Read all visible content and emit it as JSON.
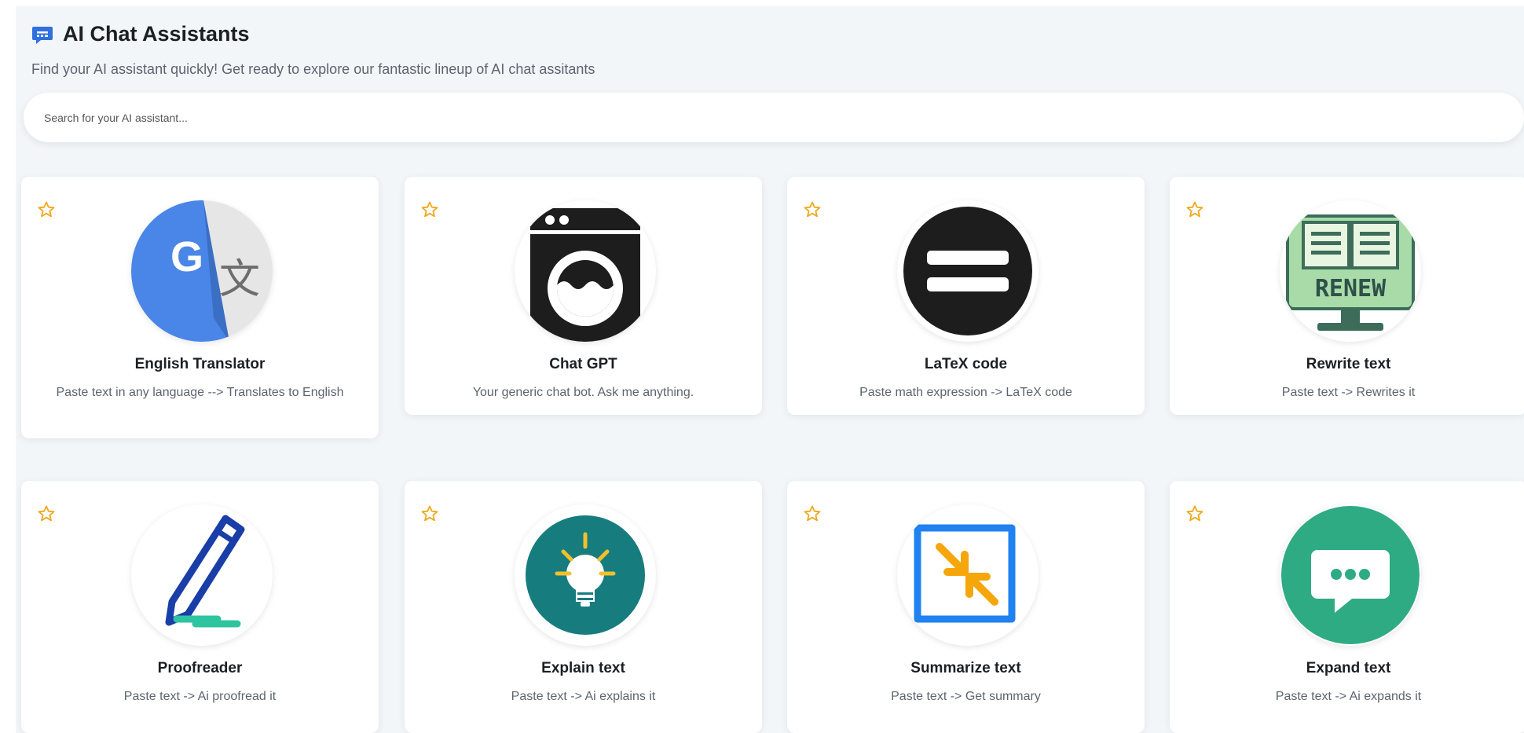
{
  "header": {
    "icon": "chat-bubble-icon",
    "title": "AI Chat Assistants",
    "subtitle": "Find your AI assistant quickly! Get ready to explore our fantastic lineup of AI chat assitants"
  },
  "search": {
    "placeholder": "Search for your AI assistant...",
    "value": ""
  },
  "colors": {
    "star": "#f0a81c",
    "title_icon": "#2f6fe0",
    "background": "#f3f6f9"
  },
  "assistants": [
    {
      "name": "English Translator",
      "description": "Paste text in any language --> Translates to English",
      "icon": "google-translate-icon"
    },
    {
      "name": "Chat GPT",
      "description": "Your generic chat bot. Ask me anything.",
      "icon": "washing-machine-icon"
    },
    {
      "name": "LaTeX code",
      "description": "Paste math expression -> LaTeX code",
      "icon": "equals-sign-icon"
    },
    {
      "name": "Rewrite text",
      "description": "Paste text -> Rewrites it",
      "icon": "renew-book-icon"
    },
    {
      "name": "Proofreader",
      "description": "Paste text -> Ai proofread it",
      "icon": "pen-icon"
    },
    {
      "name": "Explain text",
      "description": "Paste text -> Ai explains it",
      "icon": "lightbulb-icon"
    },
    {
      "name": "Summarize text",
      "description": "Paste text -> Get summary",
      "icon": "compress-arrows-icon"
    },
    {
      "name": "Expand text",
      "description": "Paste text -> Ai expands it",
      "icon": "speech-bubble-dots-icon"
    }
  ]
}
